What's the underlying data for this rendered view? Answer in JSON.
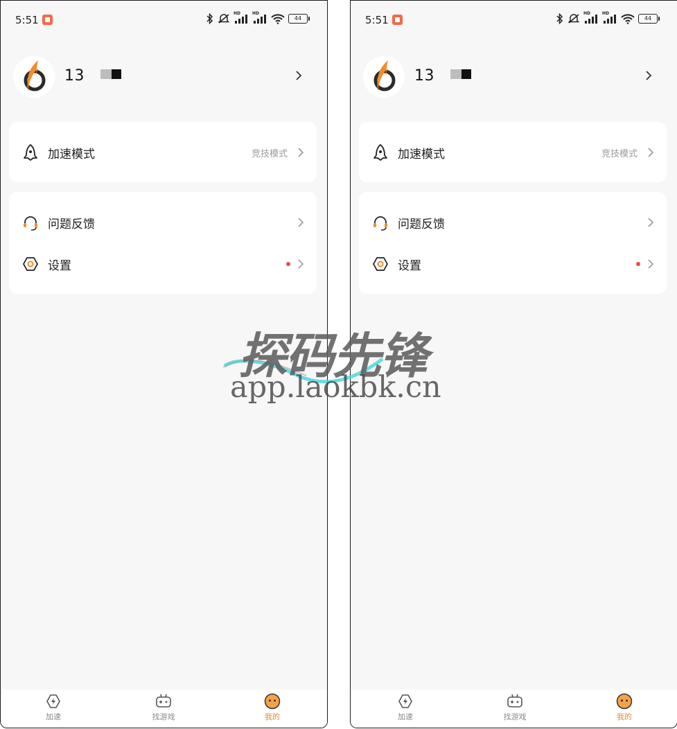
{
  "status_bar": {
    "time": "5:51",
    "battery": "44",
    "hd1": "HD",
    "hd2": "HD"
  },
  "profile": {
    "username": "13"
  },
  "mode_card": {
    "label": "加速模式",
    "value": "竞技模式"
  },
  "menu": [
    {
      "label": "问题反馈"
    },
    {
      "label": "设置"
    }
  ],
  "tabs": [
    {
      "label": "加速",
      "active": false
    },
    {
      "label": "找游戏",
      "active": false
    },
    {
      "label": "我的",
      "active": true
    }
  ],
  "watermark": {
    "title": "探码先锋",
    "url": "app.laokbk.cn"
  },
  "colors": {
    "accent": "#f08a24",
    "badge": "#ee4b4b",
    "background": "#f7f7f7"
  }
}
